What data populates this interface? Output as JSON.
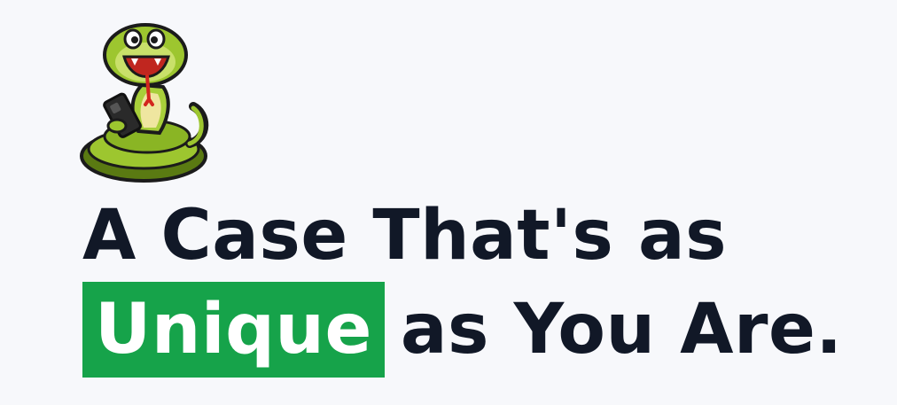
{
  "headline": {
    "line1": "A Case That's as",
    "highlight": "Unique",
    "line2_rest": "as You Are."
  },
  "colors": {
    "background": "#f7f8fb",
    "text": "#111827",
    "highlight": "#16a34a",
    "highlight_text": "#ffffff"
  },
  "mascot": {
    "icon": "snake-mascot-holding-phone"
  }
}
